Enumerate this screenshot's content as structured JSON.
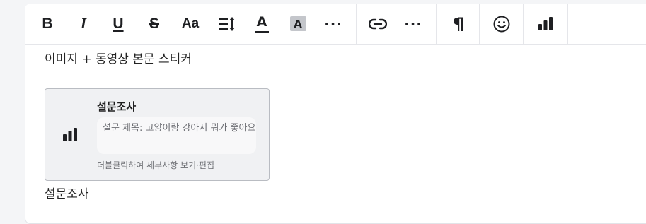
{
  "toolbar": {
    "bold": "B",
    "italic": "I",
    "underline": "U",
    "strike": "S",
    "font_size": "Aa",
    "font_color": "A",
    "bg_color": "A",
    "more1": "···",
    "more2": "···"
  },
  "content": {
    "media_caption": "이미지 + 동영상 본문 스티커",
    "poll": {
      "title": "설문조사",
      "question": "설문 제목: 고양이랑 강아지 뭐가 좋아요",
      "hint": "더블클릭하여 세부사항 보기·편집"
    },
    "poll_caption": "설문조사"
  }
}
